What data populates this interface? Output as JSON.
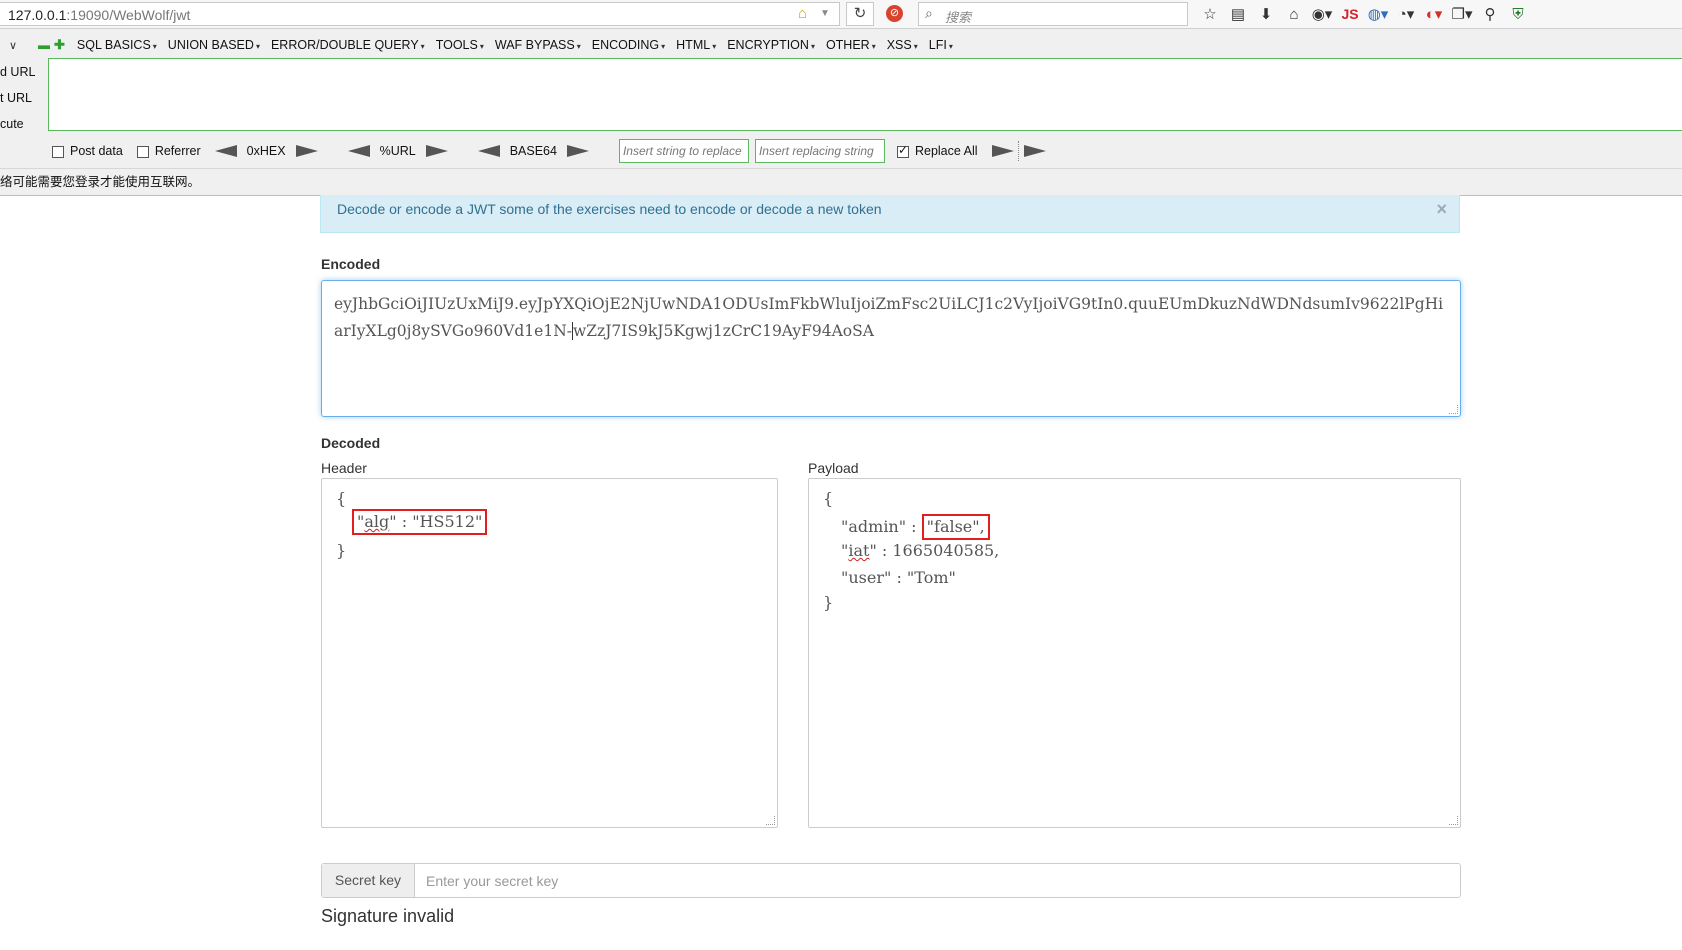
{
  "browser": {
    "url_host": "127.0.0.1",
    "url_rest": ":19090/WebWolf/jwt",
    "search_placeholder": "搜索",
    "js_label": "JS"
  },
  "hackbar": {
    "menu": [
      "SQL BASICS",
      "UNION BASED",
      "ERROR/DOUBLE QUERY",
      "TOOLS",
      "WAF BYPASS",
      "ENCODING",
      "HTML",
      "ENCRYPTION",
      "OTHER",
      "XSS",
      "LFI"
    ],
    "side_labels": [
      "d URL",
      "t URL",
      "cute"
    ],
    "post_data": "Post data",
    "referrer": "Referrer",
    "hex": "0xHEX",
    "url_enc": "%URL",
    "base64": "BASE64",
    "replace_placeholder": "Insert string to replace",
    "replacing_placeholder": "Insert replacing string",
    "replace_all": "Replace All",
    "notice": "络可能需要您登录才能使用互联网。"
  },
  "page": {
    "alert": "Decode or encode a JWT some of the exercises need to encode or decode a new token",
    "alert_close": "×",
    "encoded_label": "Encoded",
    "encoded_line1": "eyJhbGciOiJIUzUxMiJ9.eyJpYXQiOjE2NjUwNDA1ODUsImFkbWluIjoiZmFsc2UiLCJ1c2VyIjoiVG9tIn0.quuEUmDkuzNdWDNdsumIv9622lPgHiarIy",
    "encoded_line2_a": "XLg0j8ySVGo960Vd1e1N-",
    "encoded_line2_b": "wZzJ7IS9kJ5Kgwj1zCrC19AyF94AoSA",
    "decoded_label": "Decoded",
    "header_label": "Header",
    "payload_label": "Payload",
    "brace_open": "{",
    "brace_close": "}",
    "header_key": "alg",
    "header_value": "HS512",
    "payload": {
      "admin_key": "admin",
      "admin_value": "false",
      "iat_key": "iat",
      "iat_value": "1665040585",
      "user_key": "user",
      "user_value": "Tom"
    },
    "secret_addon": "Secret key",
    "secret_placeholder": "Enter your secret key",
    "signature": "Signature invalid"
  }
}
